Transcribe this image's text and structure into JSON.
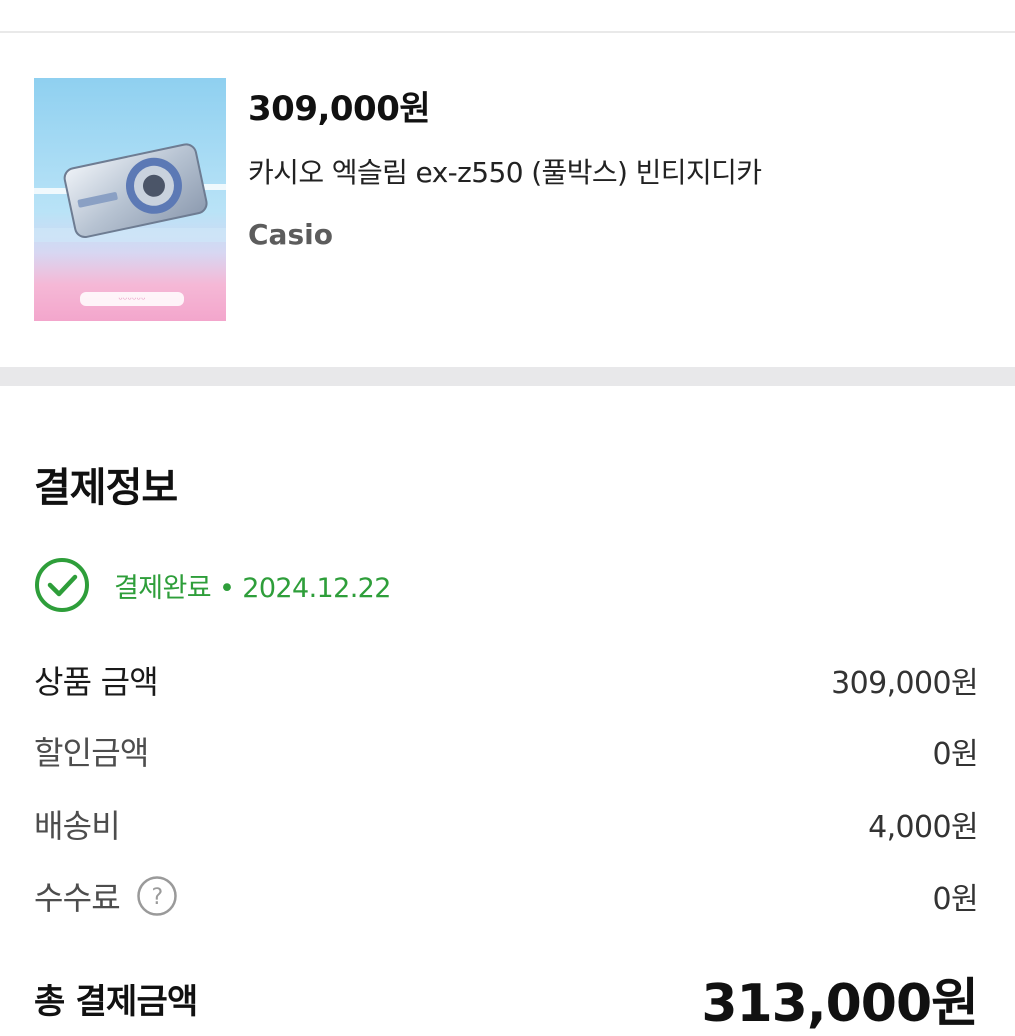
{
  "product": {
    "price": "309,000원",
    "title": "카시오 엑슬림 ex-z550 (풀박스) 빈티지디카",
    "brand": "Casio",
    "image_icon": "camera-photo",
    "image_caption": "ᵕᵕᵕᵕᵕᵕ"
  },
  "payment": {
    "section_title": "결제정보",
    "status_icon": "check-circle-icon",
    "status_text": "결제완료 • 2024.12.22",
    "status_color": "#2e9e3a",
    "rows": [
      {
        "label": "상품 금액",
        "value": "309,000원"
      },
      {
        "label": "할인금액",
        "value": "0원"
      },
      {
        "label": "배송비",
        "value": "4,000원"
      },
      {
        "label": "수수료",
        "value": "0원",
        "icon": "help-circle-icon"
      }
    ],
    "total_label": "총 결제금액",
    "total_value": "313,000원"
  }
}
